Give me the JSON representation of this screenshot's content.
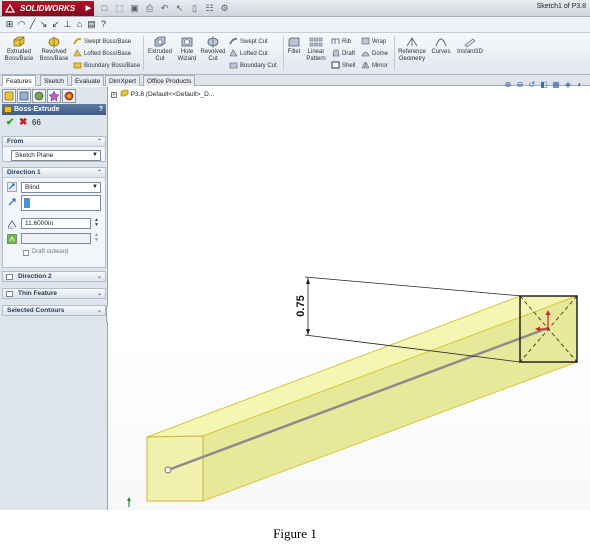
{
  "window": {
    "app_name": "SOLIDWORKS",
    "document_title": "Sketch1 of P3.8"
  },
  "ribbon": {
    "extruded_boss": "Extruded Boss/Base",
    "revolved_boss": "Revolved Boss/Base",
    "swept_boss": "Swept Boss/Base",
    "lofted_boss": "Lofted Boss/Base",
    "boundary_boss": "Boundary Boss/Base",
    "extruded_cut": "Extruded Cut",
    "hole_wizard": "Hole Wizard",
    "revolved_cut": "Revolved Cut",
    "swept_cut": "Swept Cut",
    "lofted_cut": "Lofted Cut",
    "boundary_cut": "Boundary Cut",
    "fillet": "Fillet",
    "linear_pattern": "Linear Pattern",
    "rib": "Rib",
    "draft": "Draft",
    "shell": "Shell",
    "wrap": "Wrap",
    "dome": "Dome",
    "mirror": "Mirror",
    "reference_geometry": "Reference Geometry",
    "curves": "Curves",
    "instant3d": "Instant3D"
  },
  "tabs": [
    "Features",
    "Sketch",
    "Evaluate",
    "DimXpert",
    "Office Products"
  ],
  "property_manager": {
    "title": "Boss-Extrude",
    "help": "?",
    "from": {
      "header": "From",
      "value": "Sketch Plane"
    },
    "direction1": {
      "header": "Direction 1",
      "end_condition": "Blind",
      "depth": "11.6000in",
      "draft_outward": "Draft outward"
    },
    "direction2": "Direction 2",
    "thin_feature": "Thin Feature",
    "selected_contours": "Selected Contours"
  },
  "tree": {
    "label": "P3.8  (Default<<Default>_D..."
  },
  "viewport": {
    "dimension": "0.75",
    "caption": "Figure 1"
  },
  "colors": {
    "extrude_face": "#f4f4a8",
    "extrude_edge": "#e2d34a",
    "header_blue": "#3c5c88"
  }
}
